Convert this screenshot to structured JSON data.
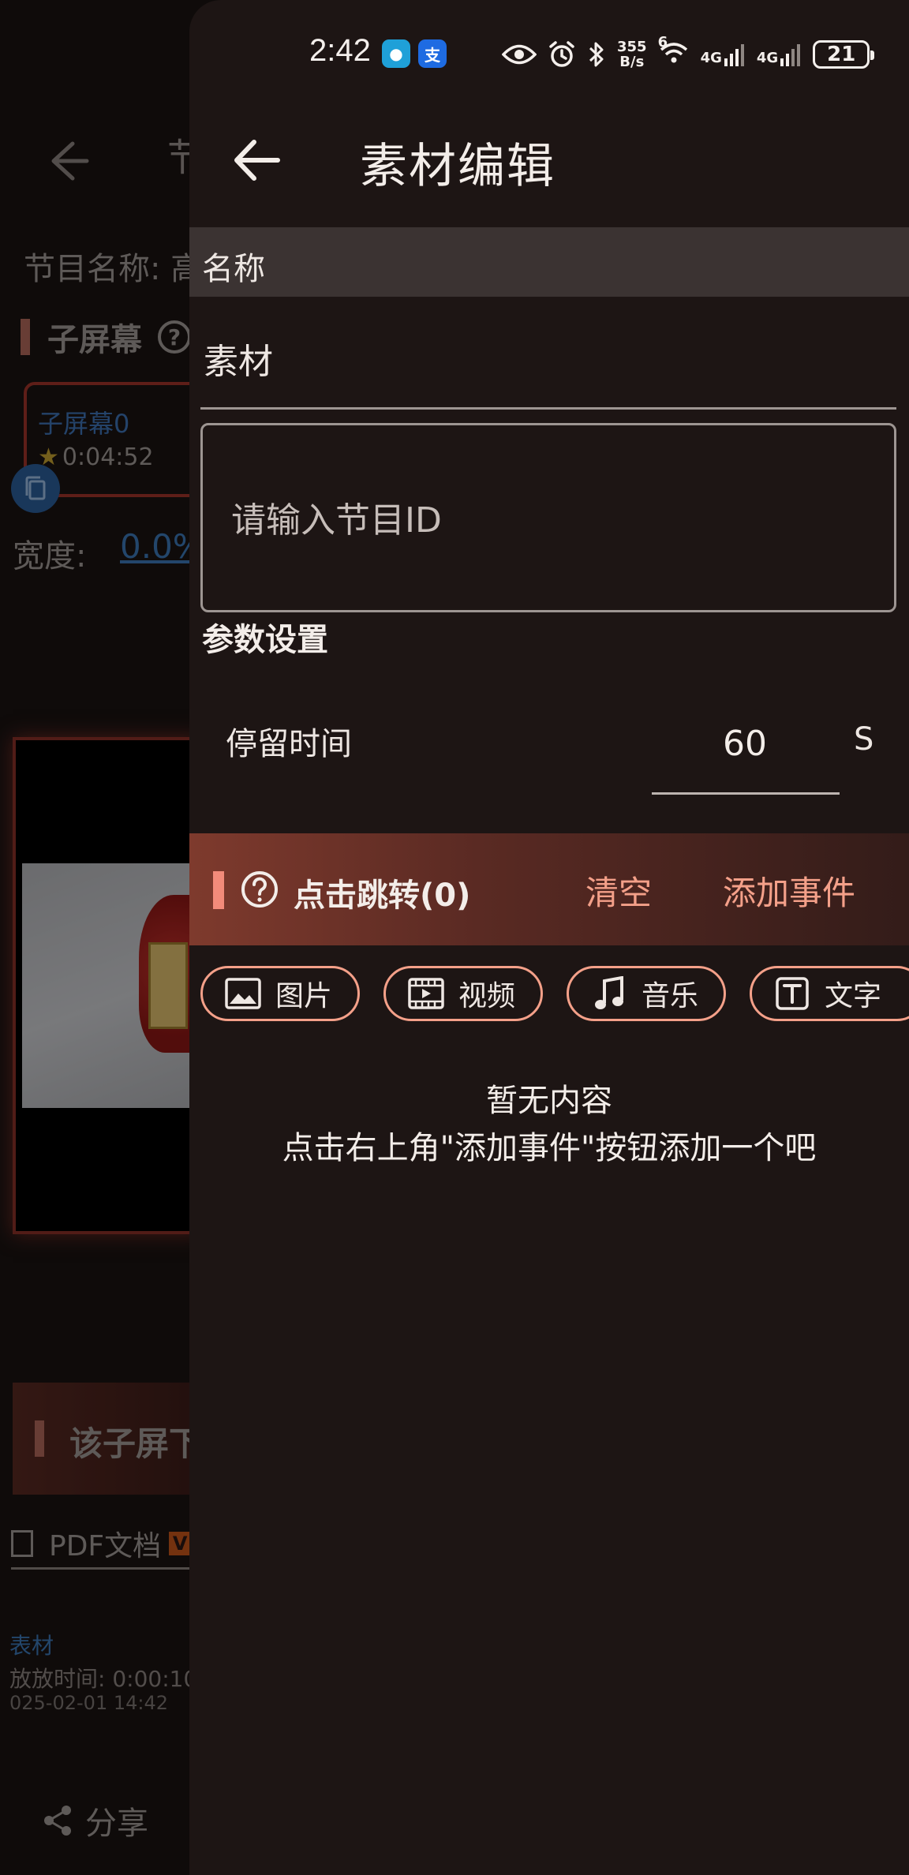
{
  "status_bar": {
    "time": "2:42",
    "net_speed_value": "355",
    "net_speed_unit": "B/s",
    "wifi_badge": "6",
    "sim1": "4G",
    "sim2": "4G",
    "battery": "21"
  },
  "background_page": {
    "title_fragment": "节",
    "program_name_label": "节目名称: 高",
    "sub_screen_title": "子屏幕",
    "sub_screen_card": {
      "name": "子屏幕0",
      "duration": "0:04:52"
    },
    "width_label": "宽度:",
    "width_value": "0.0%",
    "section_title": "该子屏下",
    "file_type": "PDF文档",
    "file_badge": "V",
    "item_name": "表材",
    "item_play_time": "放放时间: 0:00:10",
    "item_date": "025-02-01 14:42",
    "share_label": "分享"
  },
  "panel": {
    "title": "素材编辑",
    "name_header": "名称",
    "name_value": "素材",
    "id_placeholder": "请输入节目ID",
    "params_title": "参数设置",
    "stay_label": "停留时间",
    "stay_value": "60",
    "stay_unit": "S",
    "event_title": "点击跳转(0)",
    "clear_label": "清空",
    "add_event_label": "添加事件",
    "chips": [
      {
        "label": "图片",
        "icon": "image-icon"
      },
      {
        "label": "视频",
        "icon": "video-icon"
      },
      {
        "label": "音乐",
        "icon": "music-note-icon"
      },
      {
        "label": "文字",
        "icon": "text-icon"
      }
    ],
    "empty_line1": "暂无内容",
    "empty_line2": "点击右上角\"添加事件\"按钮添加一个吧"
  },
  "colors": {
    "accent": "#f4a089",
    "panel_bg": "#1d1514",
    "banner_start": "#7e3a2d",
    "link_blue": "#3d79b8"
  }
}
